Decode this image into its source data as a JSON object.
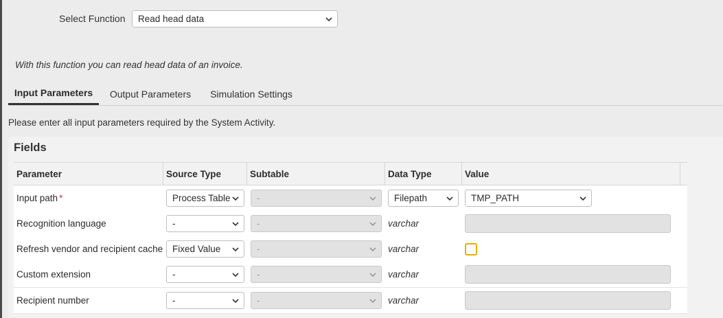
{
  "function_select": {
    "label": "Select Function",
    "value": "Read head data"
  },
  "description": "With this function you can read head data of an invoice.",
  "tabs": [
    {
      "label": "Input Parameters",
      "active": true
    },
    {
      "label": "Output Parameters",
      "active": false
    },
    {
      "label": "Simulation Settings",
      "active": false
    }
  ],
  "hint": "Please enter all input parameters required by the System Activity.",
  "fields": {
    "title": "Fields",
    "columns": [
      "Parameter",
      "Source Type",
      "Subtable",
      "Data Type",
      "Value"
    ],
    "rows": [
      {
        "parameter": "Input path",
        "required_mark": "*",
        "source_type": "Process Table",
        "subtable": "-",
        "data_type": "Filepath",
        "value": "TMP_PATH"
      },
      {
        "parameter": "Recognition language",
        "source_type": "-",
        "subtable": "-",
        "data_type": "varchar",
        "value": ""
      },
      {
        "parameter": "Refresh vendor and recipient cache",
        "source_type": "Fixed Value",
        "subtable": "-",
        "data_type": "varchar",
        "value_checked": false
      },
      {
        "parameter": "Custom extension",
        "source_type": "-",
        "subtable": "-",
        "data_type": "varchar",
        "value": ""
      },
      {
        "parameter": "Recipient number",
        "source_type": "-",
        "subtable": "-",
        "data_type": "varchar",
        "value": ""
      }
    ]
  },
  "colors": {
    "checkbox_border": "#e6b000",
    "required_mark": "#c0392b"
  }
}
